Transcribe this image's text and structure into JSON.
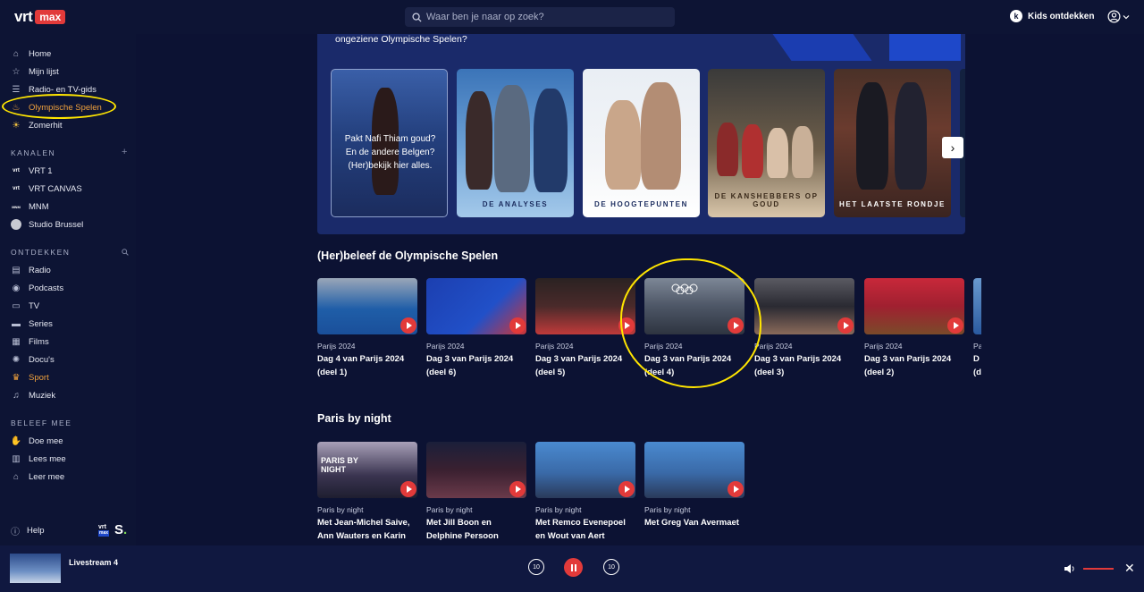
{
  "topbar": {
    "logo_vrt": "vrt",
    "logo_max": "max",
    "search_placeholder": "Waar ben je naar op zoek?",
    "kids_label": "Kids ontdekken",
    "kids_icon": "k"
  },
  "sidebar": {
    "main": [
      {
        "label": "Home",
        "icon": "home-icon"
      },
      {
        "label": "Mijn lijst",
        "icon": "star-icon"
      },
      {
        "label": "Radio- en TV-gids",
        "icon": "guide-icon"
      },
      {
        "label": "Olympische Spelen",
        "icon": "torch-icon",
        "active": true
      },
      {
        "label": "Zomerhit",
        "icon": "sun-icon"
      }
    ],
    "kanalen_heading": "KANALEN",
    "kanalen": [
      {
        "label": "VRT 1",
        "glyph": "vrt"
      },
      {
        "label": "VRT CANVAS",
        "glyph": "vrt"
      },
      {
        "label": "MNM",
        "glyph": "MNM"
      },
      {
        "label": "Studio Brussel",
        "glyph": ""
      }
    ],
    "ontdekken_heading": "ONTDEKKEN",
    "ontdekken": [
      {
        "label": "Radio",
        "icon": "radio-icon"
      },
      {
        "label": "Podcasts",
        "icon": "podcast-icon"
      },
      {
        "label": "TV",
        "icon": "tv-icon"
      },
      {
        "label": "Series",
        "icon": "series-icon"
      },
      {
        "label": "Films",
        "icon": "film-icon"
      },
      {
        "label": "Docu's",
        "icon": "docu-icon"
      },
      {
        "label": "Sport",
        "icon": "trophy-icon",
        "active": true
      },
      {
        "label": "Muziek",
        "icon": "music-icon"
      }
    ],
    "beleef_heading": "BELEEF MEE",
    "beleef": [
      {
        "label": "Doe mee",
        "icon": "doe-mee-icon"
      },
      {
        "label": "Lees mee",
        "icon": "book-icon"
      },
      {
        "label": "Leer mee",
        "icon": "graduation-icon"
      }
    ],
    "help_label": "Help",
    "brand_vrt": "vrt",
    "brand_max": "max",
    "brand_s": "S"
  },
  "panel": {
    "title": "ongeziene Olympische Spelen?",
    "card1_text": "Pakt Nafi Thiam goud? En de andere Belgen? (Her)bekijk hier alles.",
    "cards": [
      "DE ANALYSES",
      "DE HOOGTEPUNTEN",
      "DE KANSHEBBERS OP GOUD",
      "HET LAATSTE RONDJE"
    ]
  },
  "rows": {
    "herbeleef_title": "(Her)beleef de Olympische Spelen",
    "herbeleef": [
      {
        "sub": "Parijs 2024",
        "title": "Dag 4 van Parijs 2024 (deel 1)"
      },
      {
        "sub": "Parijs 2024",
        "title": "Dag 3 van Parijs 2024 (deel 6)"
      },
      {
        "sub": "Parijs 2024",
        "title": "Dag 3 van Parijs 2024 (deel 5)"
      },
      {
        "sub": "Parijs 2024",
        "title": "Dag 3 van Parijs 2024 (deel 4)"
      },
      {
        "sub": "Parijs 2024",
        "title": "Dag 3 van Parijs 2024 (deel 3)"
      },
      {
        "sub": "Parijs 2024",
        "title": "Dag 3 van Parijs 2024 (deel 2)"
      }
    ],
    "herbeleef_peek_sub": "Pa",
    "herbeleef_peek_title": "D (d",
    "paris_title": "Paris by night",
    "paris": [
      {
        "sub": "Paris by night",
        "title": "Met Jean-Michel Saive, Ann Wauters en Karin"
      },
      {
        "sub": "Paris by night",
        "title": "Met Jill Boon en Delphine Persoon"
      },
      {
        "sub": "Paris by night",
        "title": "Met Remco Evenepoel en Wout van Aert"
      },
      {
        "sub": "Paris by night",
        "title": "Met Greg Van Avermaet"
      }
    ],
    "paris_thumb1_text": "PARIS BY NIGHT"
  },
  "player": {
    "title": "Livestream 4",
    "rewind_label": "10",
    "forward_label": "10"
  },
  "colors": {
    "accent": "#e23a3a",
    "active": "#f0a13c",
    "background": "#0b1130",
    "annotation": "#ffe500"
  }
}
